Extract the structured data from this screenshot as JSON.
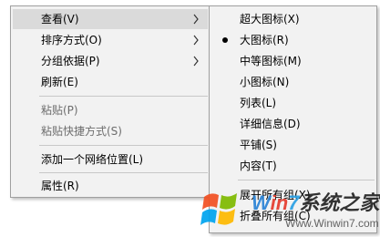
{
  "main_menu": {
    "items": [
      {
        "label": "查看(V)",
        "has_submenu": true,
        "hover": true,
        "disabled": false
      },
      {
        "label": "排序方式(O)",
        "has_submenu": true,
        "hover": false,
        "disabled": false
      },
      {
        "label": "分组依据(P)",
        "has_submenu": true,
        "hover": false,
        "disabled": false
      },
      {
        "label": "刷新(E)",
        "has_submenu": false,
        "hover": false,
        "disabled": false
      },
      {
        "label": "粘贴(P)",
        "has_submenu": false,
        "hover": false,
        "disabled": true
      },
      {
        "label": "粘贴快捷方式(S)",
        "has_submenu": false,
        "hover": false,
        "disabled": true
      },
      {
        "label": "添加一个网络位置(L)",
        "has_submenu": false,
        "hover": false,
        "disabled": false
      },
      {
        "label": "属性(R)",
        "has_submenu": false,
        "hover": false,
        "disabled": false
      }
    ]
  },
  "sub_menu": {
    "items": [
      {
        "label": "超大图标(X)",
        "selected": false
      },
      {
        "label": "大图标(R)",
        "selected": true
      },
      {
        "label": "中等图标(M)",
        "selected": false
      },
      {
        "label": "小图标(N)",
        "selected": false
      },
      {
        "label": "列表(L)",
        "selected": false
      },
      {
        "label": "详细信息(D)",
        "selected": false
      },
      {
        "label": "平铺(S)",
        "selected": false
      },
      {
        "label": "内容(T)",
        "selected": false
      },
      {
        "label": "展开所有组(X)",
        "selected": false
      },
      {
        "label": "折叠所有组(C)",
        "selected": false
      }
    ]
  },
  "watermark": {
    "brand_parts": [
      "W",
      "in",
      "7",
      "系统之家"
    ],
    "url": "Www.Winwin7.com",
    "colors": {
      "w": "#2a83d6",
      "in": "#e53b2d",
      "seven": "#2aa0e4"
    }
  },
  "colors": {
    "menu_background": "#f2f2f2",
    "hover_background": "#dadada",
    "disabled_text": "#6d6d6d",
    "separator": "#c8c8c8"
  }
}
